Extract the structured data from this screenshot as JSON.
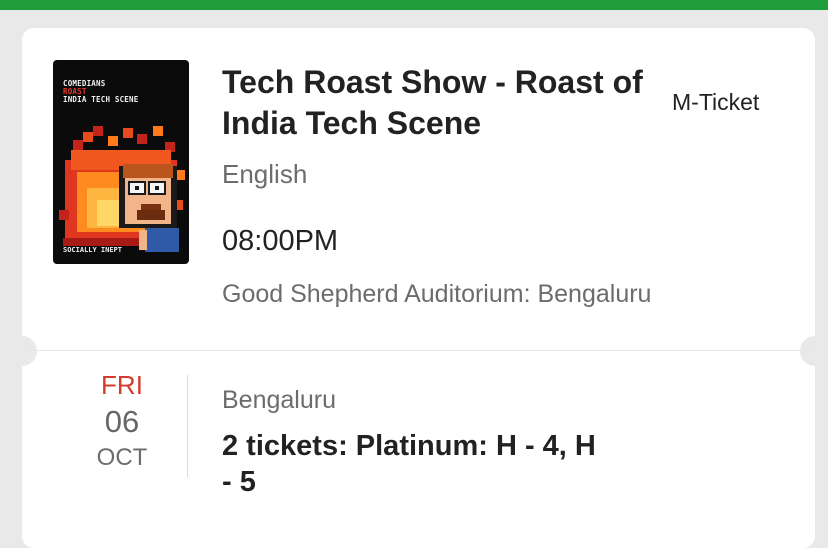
{
  "event": {
    "title": "Tech Roast Show - Roast of India Tech Scene",
    "ticket_type": "M-Ticket",
    "language": "English",
    "time": "08:00PM",
    "venue": "Good Shepherd Auditorium: Bengaluru"
  },
  "poster": {
    "line1": "COMEDIANS",
    "line2": "ROAST",
    "line3": "INDIA TECH SCENE",
    "brand": "SOCIALLY INEPT"
  },
  "booking": {
    "day": "FRI",
    "date": "06",
    "month": "OCT",
    "city": "Bengaluru",
    "tickets": "2 tickets: Platinum: H - 4,  H - 5"
  },
  "colors": {
    "header_green": "#1f9d3a",
    "day_red": "#d53a2f"
  }
}
